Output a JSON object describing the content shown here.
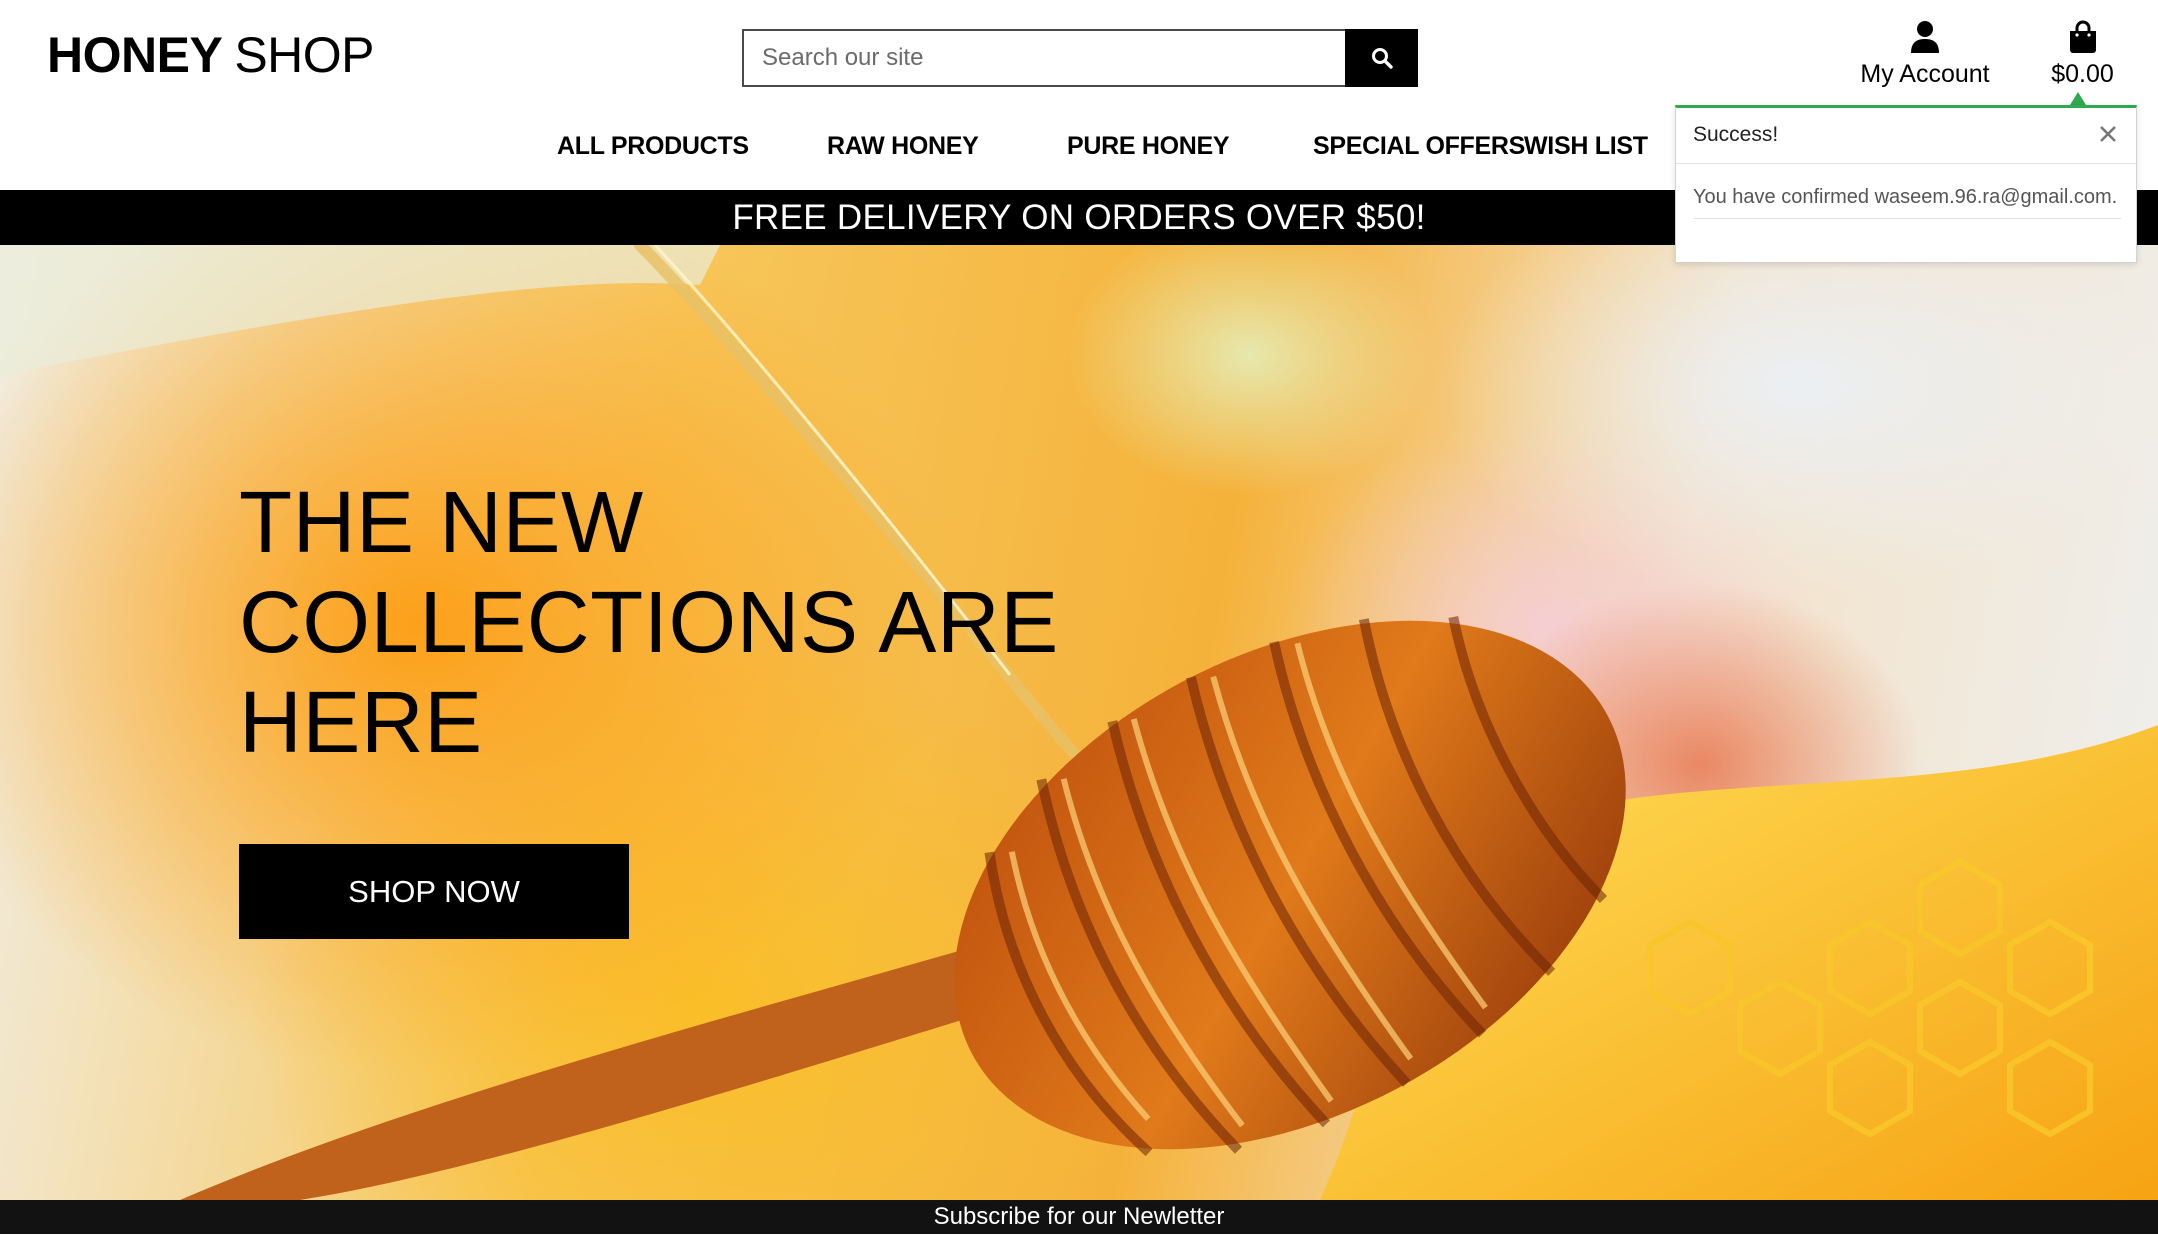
{
  "brand": {
    "name_bold": "HONEY",
    "name_rest": "SHOP"
  },
  "search": {
    "placeholder": "Search our site",
    "icon": "search-icon"
  },
  "account": {
    "label": "My Account",
    "icon": "user-icon"
  },
  "cart": {
    "total": "$0.00",
    "icon": "shopping-bag-icon"
  },
  "nav": {
    "items": [
      {
        "label": "ALL PRODUCTS"
      },
      {
        "label": "RAW HONEY"
      },
      {
        "label": "PURE HONEY"
      },
      {
        "label": "SPECIAL OFFERS"
      },
      {
        "label": "WISH LIST"
      }
    ]
  },
  "banner": {
    "text": "FREE DELIVERY ON ORDERS OVER $50!"
  },
  "hero": {
    "title_lines": [
      "THE NEW",
      "COLLECTIONS ARE",
      "HERE"
    ],
    "cta_label": "SHOP NOW"
  },
  "newsletter": {
    "text": "Subscribe for our Newletter"
  },
  "toast": {
    "title": "Success!",
    "message": "You have confirmed waseem.96.ra@gmail.com.",
    "accent_color": "#2fa84f",
    "close_icon": "close-icon"
  },
  "colors": {
    "primary": "#000000",
    "background": "#ffffff",
    "success": "#2fa84f",
    "honey": "#f5a623"
  }
}
